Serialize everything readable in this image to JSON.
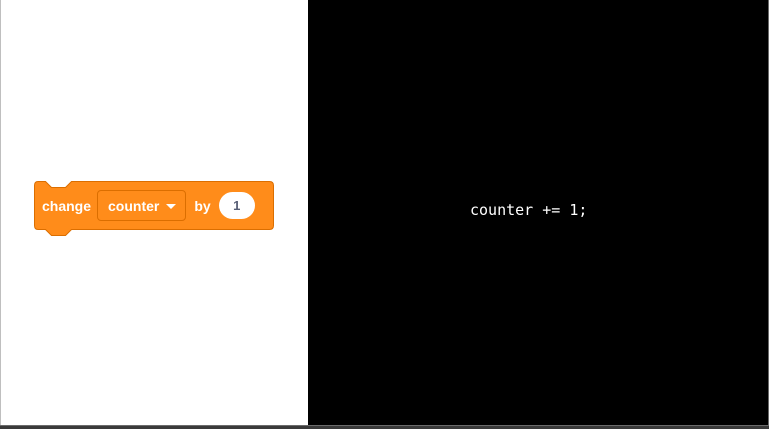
{
  "block": {
    "keyword_change": "change",
    "variable": "counter",
    "keyword_by": "by",
    "amount": "1",
    "color": "#ff8c1a",
    "border_color": "#db6e00"
  },
  "code": {
    "text": "counter += 1;"
  }
}
